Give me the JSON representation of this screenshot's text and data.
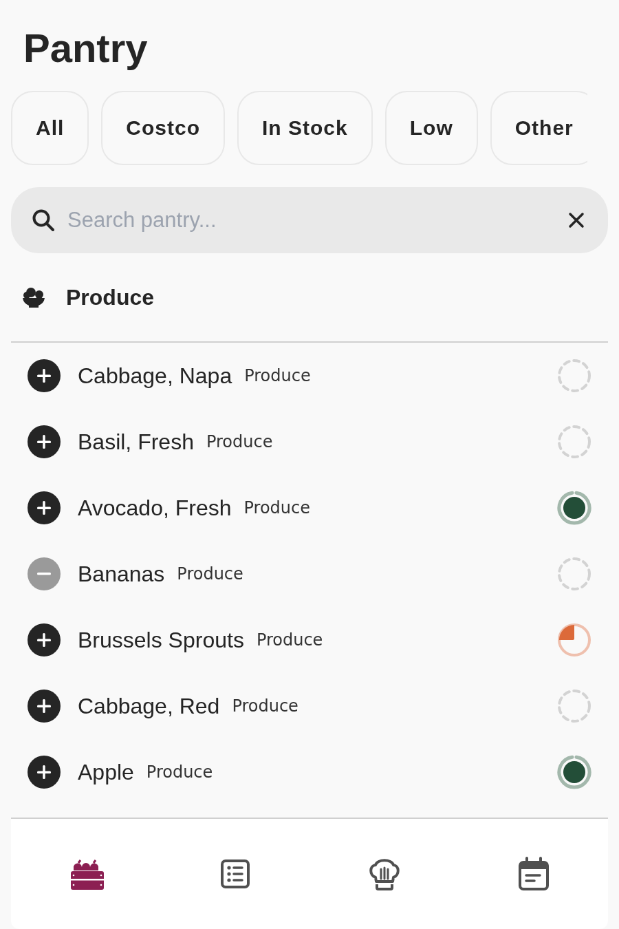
{
  "title": "Pantry",
  "filters": [
    {
      "label": "All"
    },
    {
      "label": "Costco"
    },
    {
      "label": "In Stock"
    },
    {
      "label": "Low"
    },
    {
      "label": "Other"
    }
  ],
  "search": {
    "placeholder": "Search pantry..."
  },
  "section": {
    "title": "Produce"
  },
  "items": [
    {
      "name": "Cabbage, Napa",
      "category": "Produce",
      "in_list": false,
      "kind": "empty"
    },
    {
      "name": "Basil, Fresh",
      "category": "Produce",
      "in_list": false,
      "kind": "empty"
    },
    {
      "name": "Avocado, Fresh",
      "category": "Produce",
      "in_list": false,
      "kind": "full"
    },
    {
      "name": "Bananas",
      "category": "Produce",
      "in_list": true,
      "kind": "empty"
    },
    {
      "name": "Brussels Sprouts",
      "category": "Produce",
      "in_list": false,
      "kind": "low"
    },
    {
      "name": "Cabbage, Red",
      "category": "Produce",
      "in_list": false,
      "kind": "empty"
    },
    {
      "name": "Apple",
      "category": "Produce",
      "in_list": false,
      "kind": "full"
    }
  ],
  "nav": [
    {
      "kind": "crate",
      "selected": true
    },
    {
      "kind": "list",
      "selected": false
    },
    {
      "kind": "chef",
      "selected": false
    },
    {
      "kind": "calendar",
      "selected": false
    }
  ]
}
